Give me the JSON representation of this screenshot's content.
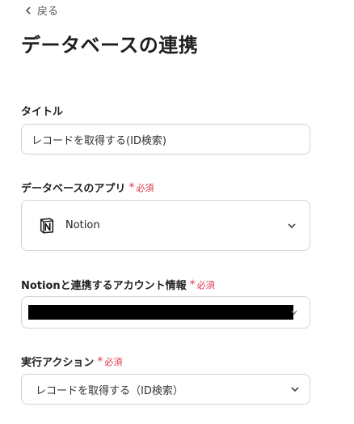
{
  "nav": {
    "back_label": "戻る"
  },
  "page": {
    "title": "データベースの連携"
  },
  "fields": {
    "title": {
      "label": "タイトル",
      "value": "レコードを取得する(ID検索)"
    },
    "app": {
      "label": "データベースのアプリ",
      "required": "必須",
      "value": "Notion"
    },
    "account": {
      "label": "Notionと連携するアカウント情報",
      "required": "必須"
    },
    "action": {
      "label": "実行アクション",
      "required": "必須",
      "value": "レコードを取得する（ID検索）"
    }
  },
  "colors": {
    "required": "#e0334a",
    "border": "#cfd3d8",
    "redaction": "#000000"
  },
  "icons": {
    "back": "chevron-left-icon",
    "app_logo": "notion-logo-icon",
    "dropdown": "chevron-down-icon"
  }
}
